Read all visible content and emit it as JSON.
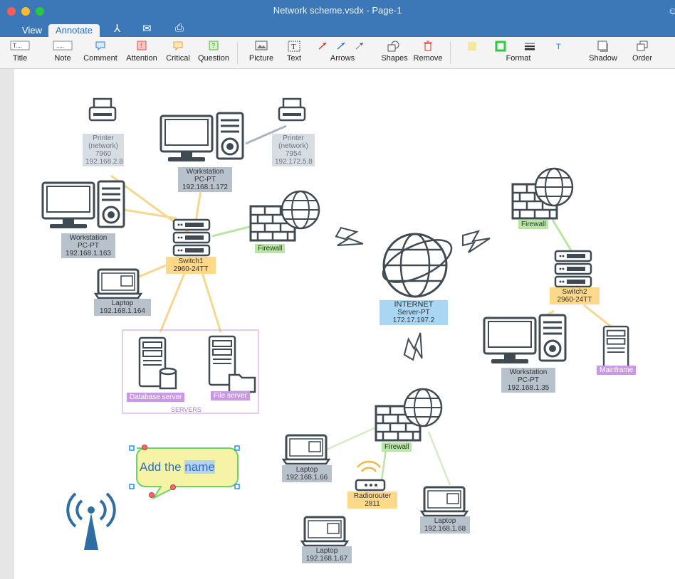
{
  "window": {
    "title": "Network scheme.vsdx - Page-1"
  },
  "tabs": {
    "view": "View",
    "annotate": "Annotate"
  },
  "ribbon": {
    "title": "Title",
    "note": "Note",
    "comment": "Comment",
    "attention": "Attention",
    "critical": "Critical",
    "question": "Question",
    "picture": "Picture",
    "text": "Text",
    "arrows": "Arrows",
    "shapes": "Shapes",
    "remove": "Remove",
    "format": "Format",
    "shadow": "Shadow",
    "order": "Order"
  },
  "diagram": {
    "printer1": {
      "name": "Printer",
      "sub": "(network)",
      "model": "7960",
      "ip": "192.168.2.8"
    },
    "printer2": {
      "name": "Printer",
      "sub": "(network)",
      "model": "7954",
      "ip": "192.172.5.8"
    },
    "ws1": {
      "name": "Workstation",
      "model": "PC-PT",
      "ip": "192.168.1.172"
    },
    "ws2": {
      "name": "Workstation",
      "model": "PC-PT",
      "ip": "192.168.1.163"
    },
    "ws3": {
      "name": "Workstation",
      "model": "PC-PT",
      "ip": "192.168.1.35"
    },
    "switch1": {
      "name": "Switch1",
      "model": "2960-24TT"
    },
    "switch2": {
      "name": "Switch2",
      "model": "2960-24TT"
    },
    "firewall1": "Firewall",
    "firewall2": "Firewall",
    "firewall3": "Firewall",
    "laptop1": {
      "name": "Laptop",
      "ip": "192.168.1.164"
    },
    "laptop2": {
      "name": "Laptop",
      "ip": "192.168.1.66"
    },
    "laptop3": {
      "name": "Laptop",
      "ip": "192.168.1.67"
    },
    "laptop4": {
      "name": "Laptop",
      "ip": "192.168.1.68"
    },
    "internet": {
      "name": "INTERNET",
      "model": "Server-PT",
      "ip": "172.17.197.2"
    },
    "dbserver": "Database server",
    "fileserver": "File server",
    "servers_group": "SERVERS",
    "mainframe": "Mainframe",
    "router": {
      "name": "Radiorouter",
      "model": "2811"
    },
    "callout": {
      "prefix": "Add the ",
      "selected": "name"
    }
  },
  "colors": {
    "titlebar": "#3c78b8",
    "accent": "#2b6fbd",
    "link_yellow": "#f6d78e",
    "link_green": "#b8e6a4"
  }
}
